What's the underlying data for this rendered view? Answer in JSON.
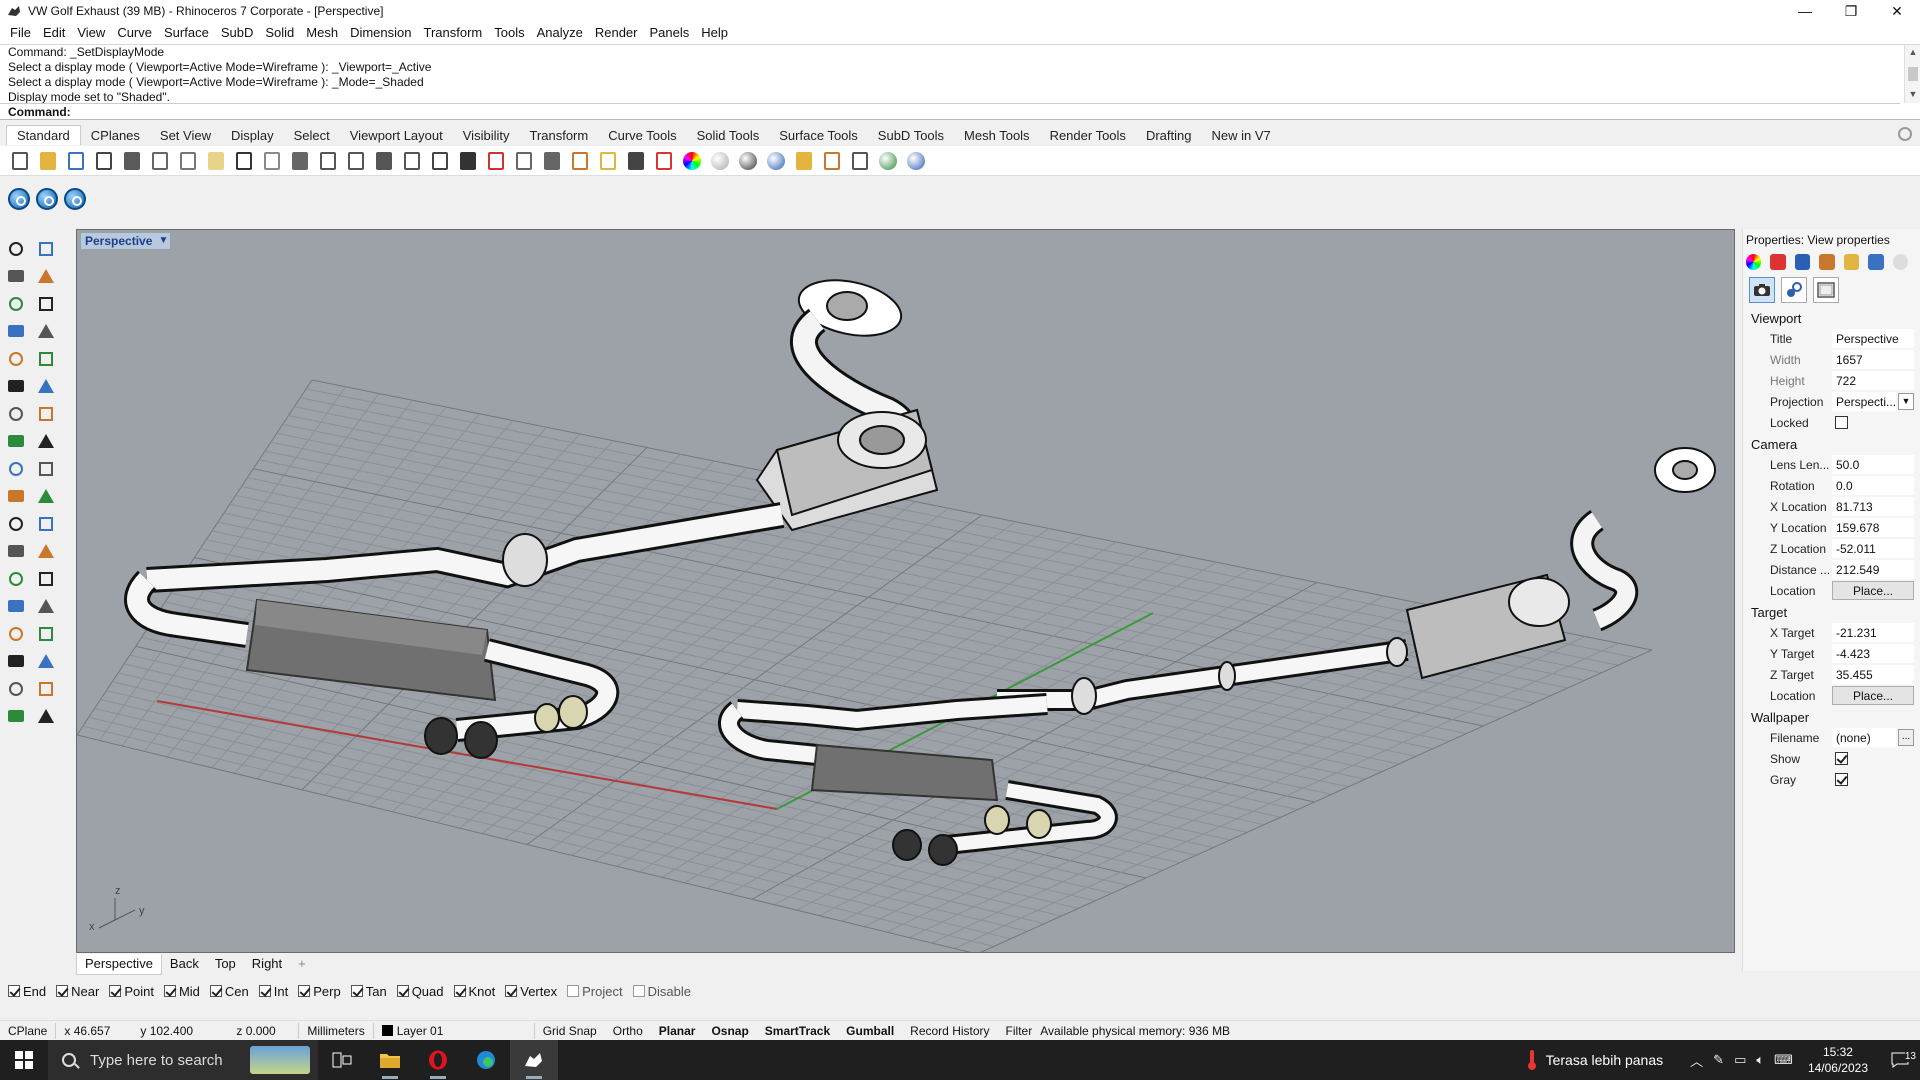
{
  "window": {
    "title": "VW Golf Exhaust (39 MB) - Rhinoceros 7 Corporate - [Perspective]",
    "controls": [
      "—",
      "❐",
      "✕"
    ]
  },
  "menu": [
    "File",
    "Edit",
    "View",
    "Curve",
    "Surface",
    "SubD",
    "Solid",
    "Mesh",
    "Dimension",
    "Transform",
    "Tools",
    "Analyze",
    "Render",
    "Panels",
    "Help"
  ],
  "command": {
    "history": [
      "Command: _SetDisplayMode",
      "Select a display mode ( Viewport=Active  Mode=Wireframe ): _Viewport=_Active",
      "Select a display mode ( Viewport=Active  Mode=Wireframe ): _Mode=_Shaded",
      "Display mode set to \"Shaded\"."
    ],
    "prompt": "Command:"
  },
  "toolbar_tabs": [
    "Standard",
    "CPlanes",
    "Set View",
    "Display",
    "Select",
    "Viewport Layout",
    "Visibility",
    "Transform",
    "Curve Tools",
    "Solid Tools",
    "Surface Tools",
    "SubD Tools",
    "Mesh Tools",
    "Render Tools",
    "Drafting",
    "New in V7"
  ],
  "toolbar_icons": [
    "new-icon",
    "open-icon",
    "save-icon",
    "print-icon",
    "import-icon",
    "cut-icon",
    "copy-icon",
    "paste-icon",
    "undo-icon",
    "pan-icon",
    "rotate-view-icon",
    "zoom-icon",
    "zoom-window-icon",
    "zoom-extents-icon",
    "zoom-selected-icon",
    "four-view-icon",
    "grid-icon",
    "car-icon",
    "history-icon",
    "osnap-icon",
    "points-icon",
    "light-icon",
    "lock-icon",
    "shield-icon",
    "color-wheel-icon",
    "sphere-gray-icon",
    "sphere-shaded-icon",
    "sphere-blue-icon",
    "wand-icon",
    "gear-icon",
    "options-icon",
    "earth-icon",
    "help-icon"
  ],
  "viewport": {
    "title": "Perspective",
    "axes": {
      "x": "x",
      "y": "y",
      "z": "z"
    }
  },
  "viewport_tabs": [
    "Perspective",
    "Back",
    "Top",
    "Right",
    "+"
  ],
  "osnaps": [
    {
      "label": "End",
      "on": true
    },
    {
      "label": "Near",
      "on": true
    },
    {
      "label": "Point",
      "on": true
    },
    {
      "label": "Mid",
      "on": true
    },
    {
      "label": "Cen",
      "on": true
    },
    {
      "label": "Int",
      "on": true
    },
    {
      "label": "Perp",
      "on": true
    },
    {
      "label": "Tan",
      "on": true
    },
    {
      "label": "Quad",
      "on": true
    },
    {
      "label": "Knot",
      "on": true
    },
    {
      "label": "Vertex",
      "on": true
    },
    {
      "label": "Project",
      "on": false
    },
    {
      "label": "Disable",
      "on": false
    }
  ],
  "status": {
    "cplane": "CPlane",
    "x": "x 46.657",
    "y": "y 102.400",
    "z": "z 0.000",
    "units": "Millimeters",
    "layer": "Layer 01",
    "grid_snap": "Grid Snap",
    "ortho": "Ortho",
    "planar": "Planar",
    "osnap": "Osnap",
    "smarttrack": "SmartTrack",
    "gumball": "Gumball",
    "record_history": "Record History",
    "filter": "Filter",
    "memory": "Available physical memory: 936 MB"
  },
  "properties": {
    "title": "Properties: View properties",
    "sections": {
      "viewport": "Viewport",
      "camera": "Camera",
      "target": "Target",
      "wallpaper": "Wallpaper"
    },
    "viewport": {
      "title_label": "Title",
      "title": "Perspective",
      "width_label": "Width",
      "width": "1657",
      "height_label": "Height",
      "height": "722",
      "projection_label": "Projection",
      "projection": "Perspecti...",
      "locked_label": "Locked"
    },
    "camera": {
      "lens_label": "Lens Len...",
      "lens": "50.0",
      "rotation_label": "Rotation",
      "rotation": "0.0",
      "xloc_label": "X Location",
      "xloc": "81.713",
      "yloc_label": "Y Location",
      "yloc": "159.678",
      "zloc_label": "Z Location",
      "zloc": "-52.011",
      "distance_label": "Distance ...",
      "distance": "212.549",
      "location_label": "Location",
      "place": "Place..."
    },
    "target": {
      "xt_label": "X Target",
      "xt": "-21.231",
      "yt_label": "Y Target",
      "yt": "-4.423",
      "zt_label": "Z Target",
      "zt": "35.455",
      "location_label": "Location",
      "place": "Place..."
    },
    "wallpaper": {
      "filename_label": "Filename",
      "filename": "(none)",
      "show_label": "Show",
      "show": true,
      "gray_label": "Gray",
      "gray": true,
      "browse": "..."
    }
  },
  "taskbar": {
    "search_placeholder": "Type here to search",
    "weather": "Terasa lebih panas",
    "time": "15:32",
    "date": "14/06/2023",
    "notifications": "13"
  }
}
